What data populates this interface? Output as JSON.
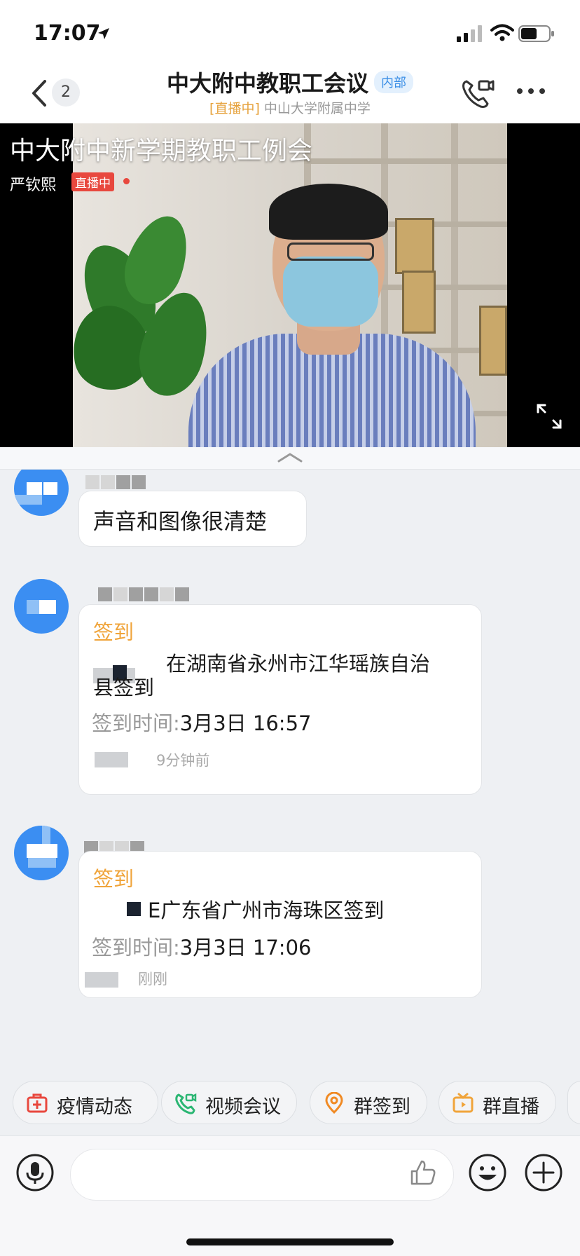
{
  "status_bar": {
    "time": "17:07"
  },
  "header": {
    "back_count": "2",
    "title": "中大附中教职工会议",
    "title_badge": "内部",
    "subtitle_live": "[直播中]",
    "subtitle_org": "中山大学附属中学"
  },
  "video": {
    "title": "中大附中新学期教职工例会",
    "author": "严钦熙",
    "live_badge": "直播中"
  },
  "messages": [
    {
      "text": "声音和图像很清楚"
    },
    {
      "card_title": "签到",
      "line1": "在湖南省永州市江华瑶族自治",
      "line2": "县签到",
      "time_label": "签到时间:",
      "time_value": "3月3日 16:57",
      "meta": "9分钟前"
    },
    {
      "card_title": "签到",
      "line1": "E广东省广州市海珠区签到",
      "time_label": "签到时间:",
      "time_value": "3月3日 17:06",
      "meta": "刚刚"
    }
  ],
  "quick_actions": [
    {
      "label": "疫情动态",
      "icon": "first-aid-icon",
      "color": "#e8483e"
    },
    {
      "label": "视频会议",
      "icon": "video-call-icon",
      "color": "#2bb673"
    },
    {
      "label": "群签到",
      "icon": "location-pin-icon",
      "color": "#f08a24"
    },
    {
      "label": "群直播",
      "icon": "tv-icon",
      "color": "#f0a43a"
    }
  ],
  "colors": {
    "accent_blue": "#3b8ef2",
    "live_red": "#e8483e",
    "signin_orange": "#f0a43a"
  }
}
